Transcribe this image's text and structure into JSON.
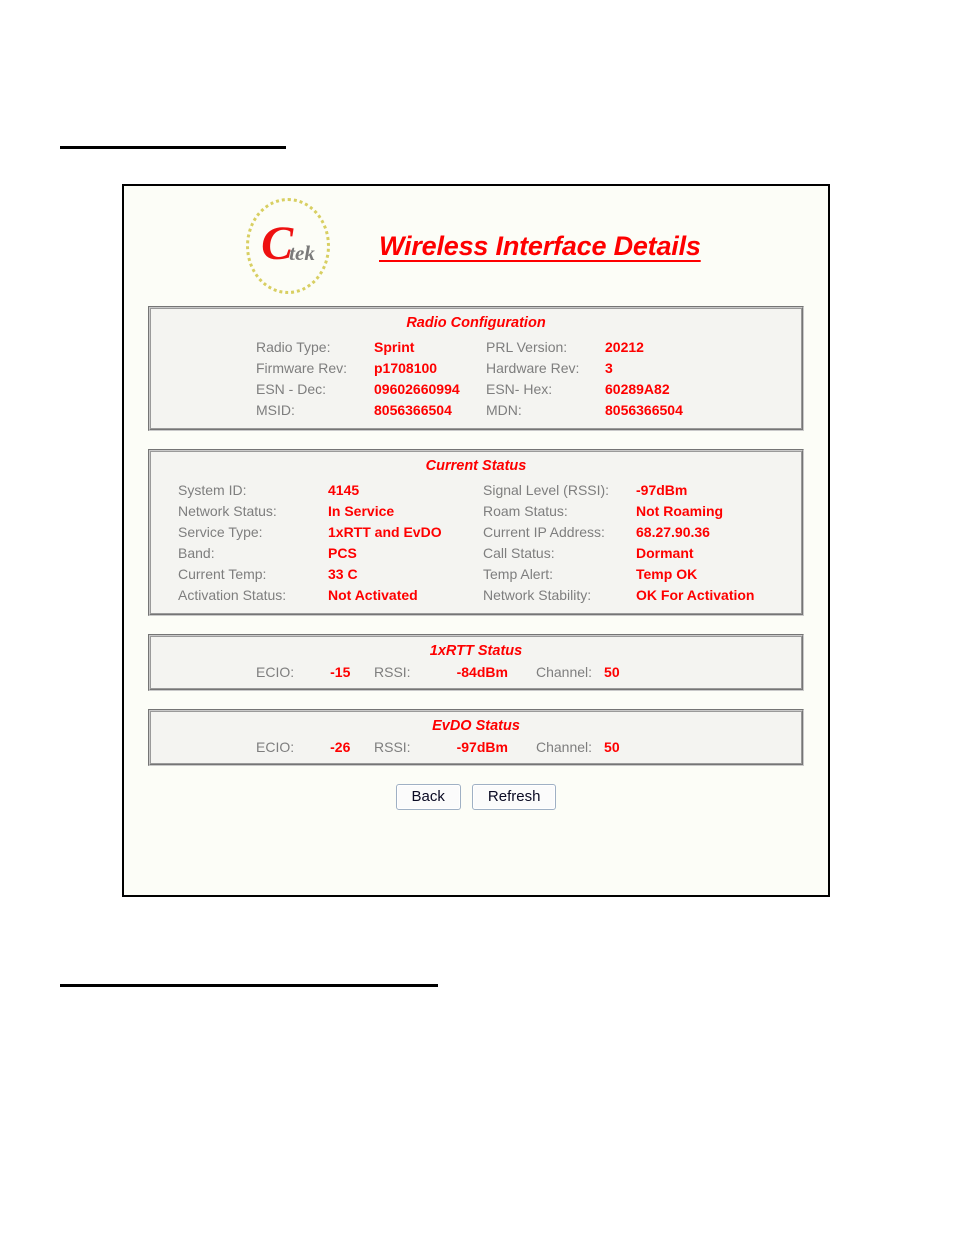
{
  "document": {
    "rules": [
      "top-rule",
      "bottom-rule"
    ]
  },
  "app": {
    "title": "Wireless Interface Details",
    "logo": {
      "name": "ctek-logo",
      "letter_c": "C",
      "letter_tek": "tek",
      "ring_color": "#d8cf62",
      "c_color": "#ee1111",
      "tek_color": "#7a7a7a"
    },
    "colors": {
      "value_red": "#fe0000",
      "label_gray": "#7e7e7e",
      "frame_background": "#fcfdf7",
      "panel_background": "#f4f4f1",
      "panel_border": "#9a9a9a",
      "button_border": "#9fb0c4"
    }
  },
  "panels": {
    "radio_configuration": {
      "title": "Radio Configuration",
      "rows": [
        {
          "label_a": "Radio Type:",
          "value_a": "Sprint",
          "label_b": "PRL Version:",
          "value_b": "20212"
        },
        {
          "label_a": "Firmware Rev:",
          "value_a": "p1708100",
          "label_b": "Hardware Rev:",
          "value_b": "3"
        },
        {
          "label_a": "ESN - Dec:",
          "value_a": "09602660994",
          "label_b": "ESN- Hex:",
          "value_b": "60289A82"
        },
        {
          "label_a": "MSID:",
          "value_a": "8056366504",
          "label_b": "MDN:",
          "value_b": "8056366504"
        }
      ]
    },
    "current_status": {
      "title": "Current Status",
      "rows": [
        {
          "label_a": "System ID:",
          "value_a": "4145",
          "label_b": "Signal Level (RSSI):",
          "value_b": "-97dBm"
        },
        {
          "label_a": "Network Status:",
          "value_a": "In Service",
          "label_b": "Roam Status:",
          "value_b": "Not Roaming"
        },
        {
          "label_a": "Service Type:",
          "value_a": "1xRTT and EvDO",
          "label_b": "Current IP Address:",
          "value_b": "68.27.90.36"
        },
        {
          "label_a": "Band:",
          "value_a": "PCS",
          "label_b": "Call Status:",
          "value_b": "Dormant"
        },
        {
          "label_a": "Current Temp:",
          "value_a": "33 C",
          "label_b": "Temp Alert:",
          "value_b": "Temp OK"
        },
        {
          "label_a": "Activation Status:",
          "value_a": "Not Activated",
          "label_b": "Network Stability:",
          "value_b": "OK For Activation"
        }
      ]
    },
    "onexrtt_status": {
      "title": "1xRTT Status",
      "ecio_label": "ECIO:",
      "ecio_value": "-15",
      "rssi_label": "RSSI:",
      "rssi_value": "-84dBm",
      "channel_label": "Channel:",
      "channel_value": "50"
    },
    "evdo_status": {
      "title": "EvDO Status",
      "ecio_label": "ECIO:",
      "ecio_value": "-26",
      "rssi_label": "RSSI:",
      "rssi_value": "-97dBm",
      "channel_label": "Channel:",
      "channel_value": "50"
    }
  },
  "buttons": {
    "back": "Back",
    "refresh": "Refresh"
  }
}
